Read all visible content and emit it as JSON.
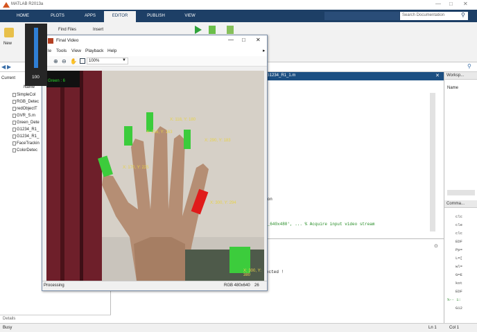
{
  "titlebar": {
    "title": "MATLAB R2013a"
  },
  "tabs": [
    "HOME",
    "PLOTS",
    "APPS",
    "EDITOR",
    "PUBLISH",
    "VIEW"
  ],
  "search": {
    "placeholder": "Search Documentation"
  },
  "ribbon": {
    "find_files": "Find Files",
    "insert": "Insert",
    "new": "New"
  },
  "current_folder": {
    "title": "Current",
    "column": "Name",
    "files": [
      "SimpleCol",
      "RGB_Detec",
      "redObjectT",
      "GVR_S.m",
      "Green_Dete",
      "G1234_R1_",
      "G1234_R1_",
      "FaceTrackin",
      "ColorDetec"
    ],
    "details": "Details"
  },
  "editor": {
    "tab": "G1234_R1_1.m",
    "lines": [
      {
        "text": "ion",
        "color": "#222"
      },
      {
        "text": "2_640x480', ... % Acquire input video stream",
        "color": "#228b22"
      }
    ]
  },
  "command_window": {
    "text": "ected !"
  },
  "workspace": {
    "title": "Worksp...",
    "column": "Name"
  },
  "command_history": {
    "title": "Comma...",
    "items": [
      "clc",
      "cle",
      "clc",
      "EDF",
      "Pp=",
      "L=[",
      "wl=",
      "G=E",
      "kot",
      "EDF",
      "%-- 1:",
      "G12"
    ]
  },
  "statusbar": {
    "left": "Busy",
    "ln": "Ln  1",
    "col": "Col  1"
  },
  "video_window": {
    "title": "Final Video",
    "menu": [
      "le",
      "Tools",
      "View",
      "Playback",
      "Help"
    ],
    "zoom": "100%",
    "status_left": "Processing",
    "status_res": "RGB 480x640",
    "status_frame": "26",
    "overlay_text": "Green : 6",
    "labels": [
      "X: 118, Y: 180",
      "X: 216, Y: 163",
      "X: 170, Y: 225",
      "X: 290, Y: 183",
      "X: 300, Y: 294",
      "X: 300, Y: 380"
    ]
  },
  "volume": {
    "value": "100"
  }
}
